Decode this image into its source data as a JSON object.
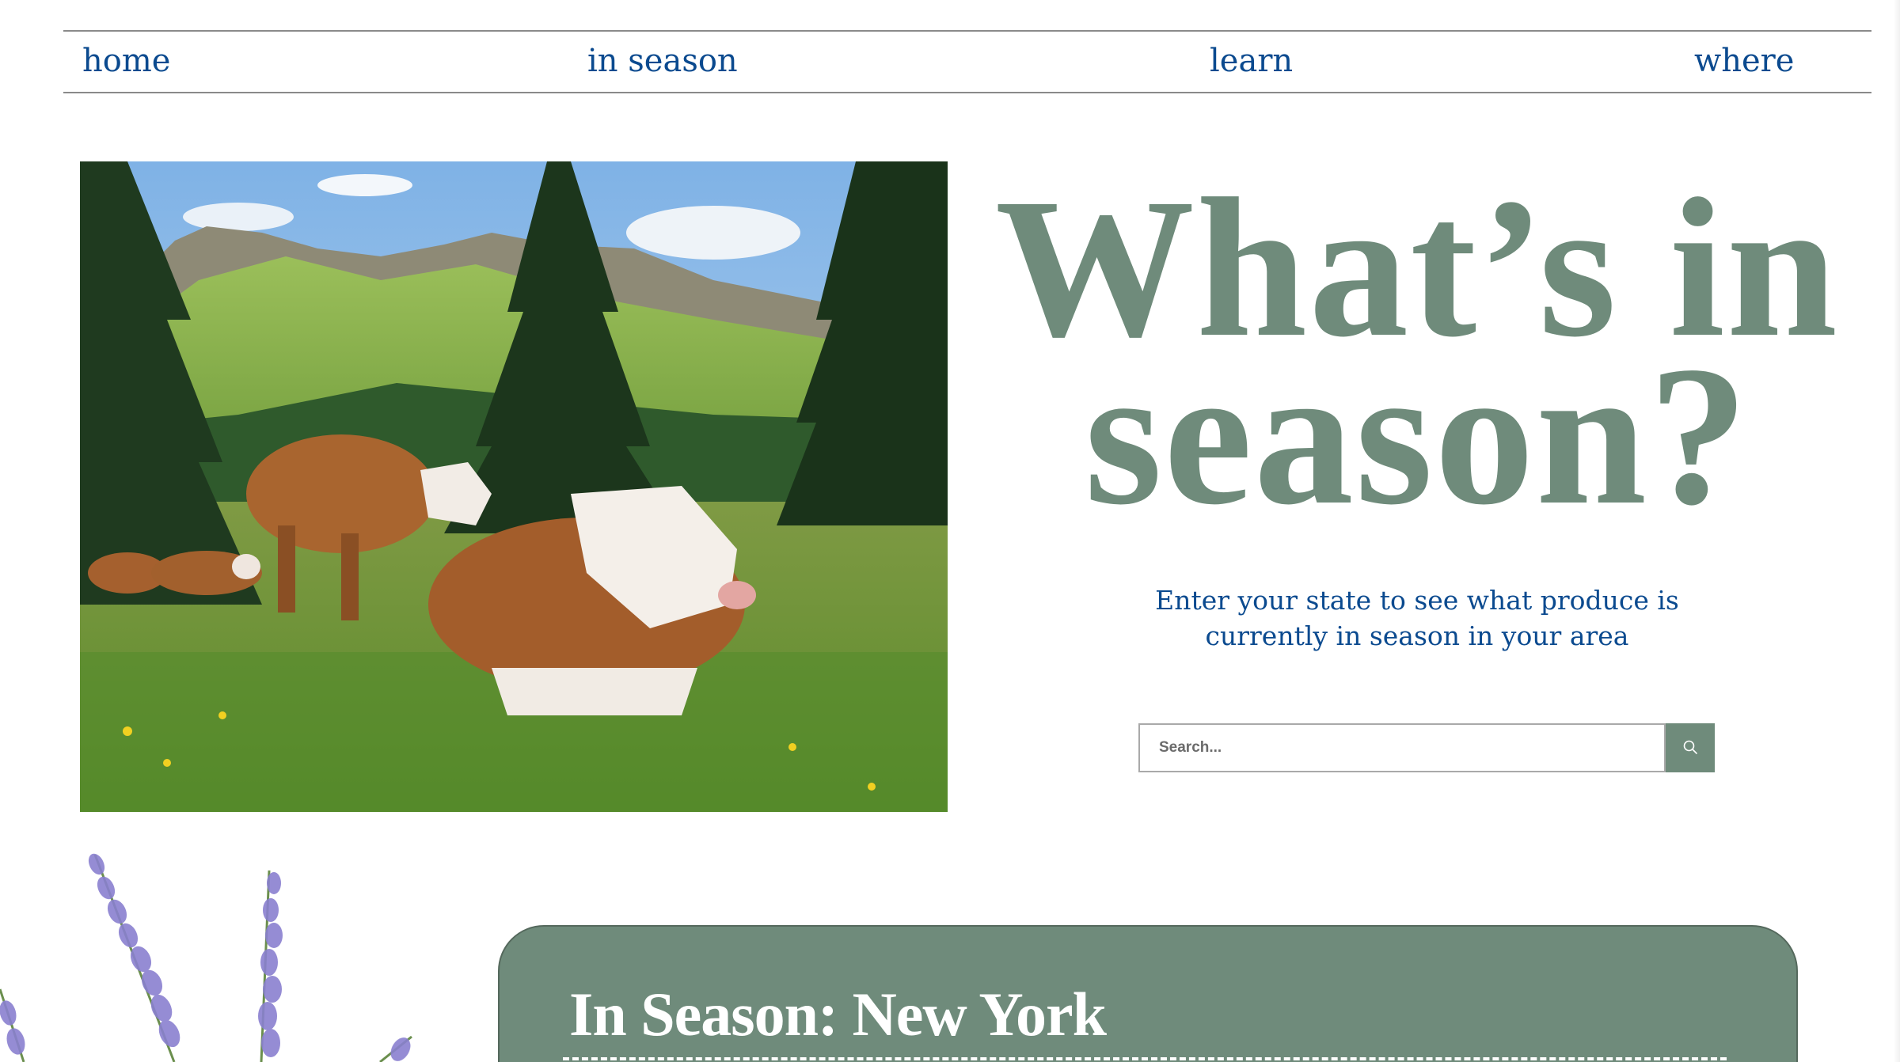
{
  "nav": {
    "items": [
      {
        "label": "home"
      },
      {
        "label": "in season"
      },
      {
        "label": "learn"
      },
      {
        "label": "where"
      }
    ]
  },
  "hero": {
    "headline_line1": "What’s in",
    "headline_line2": "season?",
    "subtitle": "Enter your state to see what produce is currently in season in your area"
  },
  "search": {
    "placeholder": "Search...",
    "icon": "search-icon"
  },
  "season_card": {
    "title": "In Season: New York"
  },
  "colors": {
    "nav_text": "#0b4a8f",
    "accent_green": "#6f8b7b",
    "card_text": "#ffffff"
  }
}
